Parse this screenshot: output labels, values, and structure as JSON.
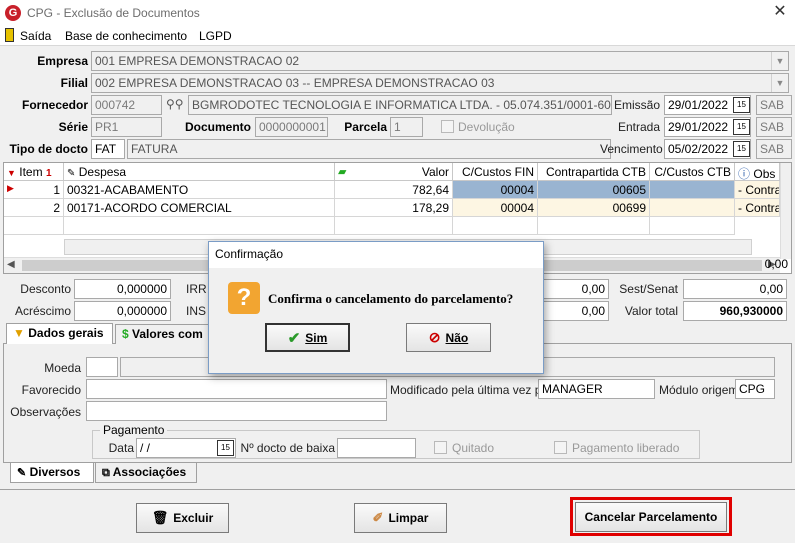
{
  "window": {
    "title": "CPG - Exclusão de Documentos",
    "app_icon": "G"
  },
  "menu": {
    "saida": "Saída",
    "base": "Base de conhecimento",
    "lgpd": "LGPD"
  },
  "header": {
    "empresa_label": "Empresa",
    "empresa_value": "001 EMPRESA DEMONSTRACAO 02",
    "filial_label": "Filial",
    "filial_value": "002 EMPRESA DEMONSTRACAO 03 -- EMPRESA DEMONSTRACAO 03",
    "fornecedor_label": "Fornecedor",
    "fornecedor_code": "000742",
    "fornecedor_name": "BGMRODOTEC TECNOLOGIA E INFORMATICA LTDA. - 05.074.351/0001-60",
    "emissao_label": "Emissão",
    "emissao_value": "29/01/2022",
    "serie_label": "Série",
    "serie_value": "PR1",
    "documento_label": "Documento",
    "documento_value": "0000000001",
    "parcela_label": "Parcela",
    "parcela_value": "1",
    "devolucao_label": "Devolução",
    "entrada_label": "Entrada",
    "entrada_value": "29/01/2022",
    "tipo_label": "Tipo de docto",
    "tipo_code": "FAT",
    "tipo_name": "FATURA",
    "vencimento_label": "Vencimento",
    "vencimento_value": "05/02/2022",
    "sab": "SAB"
  },
  "grid": {
    "columns": [
      "Item",
      "Despesa",
      "Valor",
      "C/Custos FIN",
      "Contrapartida CTB",
      "C/Custos CTB",
      "Obs"
    ],
    "rows": [
      {
        "item": "1",
        "despesa": "00321-ACABAMENTO",
        "valor": "782,64",
        "ccfin": "00004",
        "contrapartida": "00605",
        "ccctb": "",
        "obs": "- Contra"
      },
      {
        "item": "2",
        "despesa": "00171-ACORDO COMERCIAL",
        "valor": "178,29",
        "ccfin": "00004",
        "contrapartida": "00699",
        "ccctb": "",
        "obs": "- Contra"
      }
    ]
  },
  "totals": {
    "desconto_label": "Desconto",
    "desconto_value": "0,000000",
    "irr_label": "IRR",
    "acrescimo_label": "Acréscimo",
    "acrescimo_value": "0,000000",
    "ins_label": "INS",
    "mid1": "0,00",
    "mid2": "0,00",
    "sest_label": "Sest/Senat",
    "sest_value": "0,00",
    "valor_total_label": "Valor total",
    "valor_total_value": "960,930000",
    "scroll_total": "0,00"
  },
  "tabs": {
    "dados_gerais": "Dados gerais",
    "valores": "Valores com"
  },
  "dados": {
    "moeda_label": "Moeda",
    "favorecido_label": "Favorecido",
    "obs_label": "Observações",
    "modificado_label": "Modificado pela última vez por",
    "modificado_value": "MANAGER",
    "modulo_label": "Módulo origem",
    "modulo_value": "CPG",
    "pagamento_label": "Pagamento",
    "data_label": "Data",
    "data_value": " /  /",
    "ndocto_label": "Nº docto de baixa",
    "quitado_label": "Quitado",
    "pagliberado_label": "Pagamento liberado"
  },
  "bottom_tabs": {
    "diversos": "Diversos",
    "associacoes": "Associações"
  },
  "buttons": {
    "excluir": "Excluir",
    "limpar": "Limpar",
    "cancelar": "Cancelar Parcelamento"
  },
  "dialog": {
    "title": "Confirmação",
    "message": "Confirma o cancelamento do parcelamento?",
    "sim": "Sim",
    "nao": "Não"
  },
  "colors": {
    "selection": "#99b4d1",
    "highlight_border": "#e00000",
    "row_selected": "#fdf6e3"
  }
}
